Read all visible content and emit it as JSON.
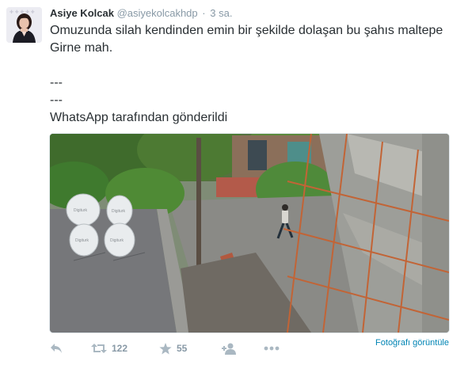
{
  "tweet": {
    "fullname": "Asiye Kolcak",
    "username": "@asiyekolcakhdp",
    "separator": "·",
    "time": "3 sa.",
    "text": "Omuzunda silah kendinden emin bir şekilde dolaşan bu şahıs maltepe Girne mah.\n\n---\n---\nWhatsApp tarafından gönderildi",
    "media": {
      "dish_labels": [
        "Digiturk",
        "Digiturk",
        "Digiturk",
        "Digiturk"
      ]
    }
  },
  "actions": {
    "reply_icon": "reply-icon",
    "retweet_icon": "retweet-icon",
    "retweet_count": "122",
    "like_icon": "star-icon",
    "like_count": "55",
    "follow_icon": "follow-icon",
    "more_icon": "more-icon",
    "view_photo": "Fotoğrafı görüntüle"
  },
  "colors": {
    "text": "#292f33",
    "muted": "#8899a6",
    "link": "#0084b4",
    "icon": "#aab8c2"
  }
}
